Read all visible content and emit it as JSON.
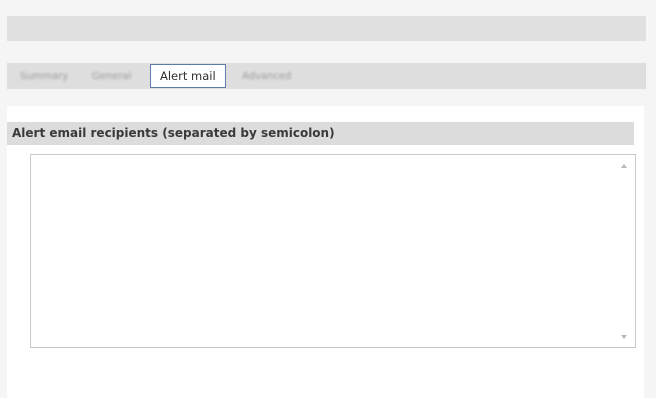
{
  "tabs": [
    {
      "label": "Summary",
      "active": false
    },
    {
      "label": "General",
      "active": false
    },
    {
      "label": "Alert mail",
      "active": true
    },
    {
      "label": "Advanced",
      "active": false
    }
  ],
  "section": {
    "title": "Alert email recipients (separated by semicolon)"
  },
  "recipients_field": {
    "value": ""
  },
  "colors": {
    "header_bg": "#dcdcdc",
    "active_tab_border": "#5b7cad",
    "frame_bg": "#f5f5f5"
  },
  "icons": {
    "scroll_up": "scroll-up-arrow-icon",
    "scroll_down": "scroll-down-arrow-icon"
  }
}
